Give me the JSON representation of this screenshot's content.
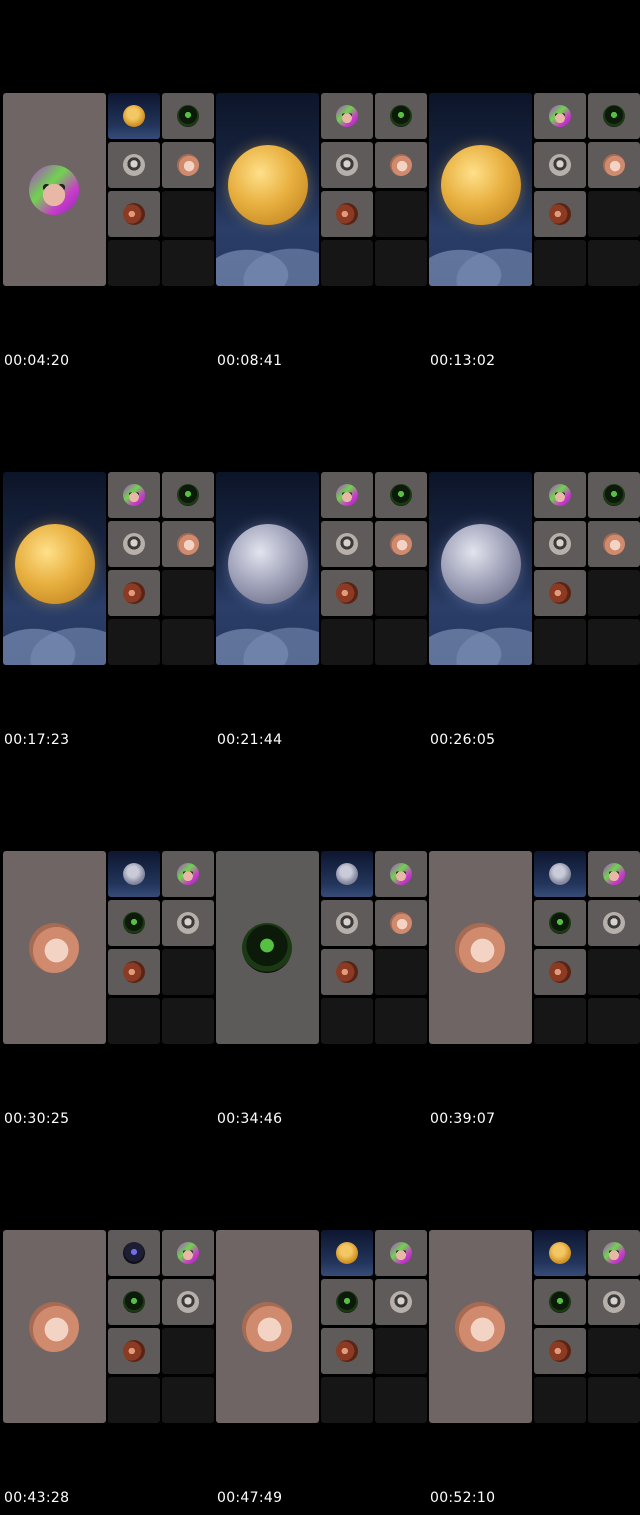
{
  "app": {
    "name": "video call recording contact sheet"
  },
  "frames": [
    {
      "time": "00:04:20",
      "main": {
        "kind": "avatar",
        "avatar": "av-purple"
      },
      "tiles": [
        "av-moon",
        "av-green",
        "av-gray",
        "av-blonde",
        "av-brown",
        "empty",
        "empty",
        "empty"
      ]
    },
    {
      "time": "00:08:41",
      "main": {
        "kind": "moon",
        "moon": "gold"
      },
      "tiles": [
        "av-purple",
        "av-green",
        "av-gray",
        "av-blonde",
        "av-brown",
        "empty",
        "empty",
        "empty"
      ]
    },
    {
      "time": "00:13:02",
      "main": {
        "kind": "moon",
        "moon": "gold"
      },
      "tiles": [
        "av-purple",
        "av-green",
        "av-gray",
        "av-blonde",
        "av-brown",
        "empty",
        "empty",
        "empty"
      ]
    },
    {
      "time": "00:17:23",
      "main": {
        "kind": "moon",
        "moon": "gold"
      },
      "tiles": [
        "av-purple",
        "av-green",
        "av-gray",
        "av-blonde",
        "av-brown",
        "empty",
        "empty",
        "empty"
      ]
    },
    {
      "time": "00:21:44",
      "main": {
        "kind": "moon",
        "moon": "gray"
      },
      "tiles": [
        "av-purple",
        "av-green",
        "av-gray",
        "av-blonde",
        "av-brown",
        "empty",
        "empty",
        "empty"
      ]
    },
    {
      "time": "00:26:05",
      "main": {
        "kind": "moon",
        "moon": "gray"
      },
      "tiles": [
        "av-purple",
        "av-green",
        "av-gray",
        "av-blonde",
        "av-brown",
        "empty",
        "empty",
        "empty"
      ]
    },
    {
      "time": "00:30:25",
      "main": {
        "kind": "avatar",
        "avatar": "av-blonde"
      },
      "tiles": [
        "av-moon-gray",
        "av-purple",
        "av-green",
        "av-gray",
        "av-brown",
        "empty",
        "empty",
        "empty"
      ]
    },
    {
      "time": "00:34:46",
      "main": {
        "kind": "avatar",
        "avatar": "av-green",
        "gray": true
      },
      "tiles": [
        "av-moon-gray",
        "av-purple",
        "av-gray",
        "av-blonde",
        "av-brown",
        "empty",
        "empty",
        "empty"
      ]
    },
    {
      "time": "00:39:07",
      "main": {
        "kind": "avatar",
        "avatar": "av-blonde"
      },
      "tiles": [
        "av-moon-gray",
        "av-purple",
        "av-green",
        "av-gray",
        "av-brown",
        "empty",
        "empty",
        "empty"
      ]
    },
    {
      "time": "00:43:28",
      "main": {
        "kind": "avatar",
        "avatar": "av-blonde"
      },
      "tiles": [
        "av-dark",
        "av-purple",
        "av-green",
        "av-gray",
        "av-brown",
        "empty",
        "empty",
        "empty"
      ]
    },
    {
      "time": "00:47:49",
      "main": {
        "kind": "avatar",
        "avatar": "av-blonde"
      },
      "tiles": [
        "av-moon",
        "av-purple",
        "av-green",
        "av-gray",
        "av-brown",
        "empty",
        "empty",
        "empty"
      ]
    },
    {
      "time": "00:52:10",
      "main": {
        "kind": "avatar",
        "avatar": "av-blonde"
      },
      "tiles": [
        "av-moon",
        "av-purple",
        "av-green",
        "av-gray",
        "av-brown",
        "empty",
        "empty",
        "empty"
      ]
    }
  ]
}
